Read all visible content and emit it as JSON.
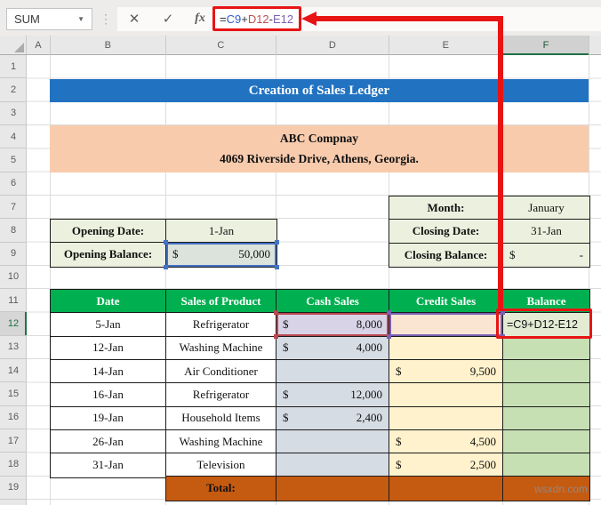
{
  "chrome": {
    "name_box": "SUM",
    "dropdown_icon": "▼",
    "cancel_icon": "✕",
    "enter_icon": "✓",
    "fx_icon": "fx",
    "formula_parts": {
      "eq": "=",
      "ref1": "C9",
      "plus": "+",
      "ref2": "D12",
      "minus": "-",
      "ref3": "E12"
    },
    "columns": [
      "A",
      "B",
      "C",
      "D",
      "E",
      "F"
    ],
    "rows": [
      "1",
      "2",
      "3",
      "4",
      "5",
      "6",
      "7",
      "8",
      "9",
      "10",
      "11",
      "12",
      "13",
      "14",
      "15",
      "16",
      "17",
      "18",
      "19"
    ],
    "selected_column": "F",
    "selected_row": "12"
  },
  "sheet": {
    "title": "Creation of Sales Ledger",
    "company_name": "ABC Compnay",
    "company_address": "4069 Riverside Drive, Athens, Georgia.",
    "opening": {
      "date_label": "Opening Date:",
      "date_value": "1-Jan",
      "balance_label": "Opening Balance:",
      "currency": "$",
      "balance_value": "50,000"
    },
    "closing": {
      "month_label": "Month:",
      "month_value": "January",
      "date_label": "Closing Date:",
      "date_value": "31-Jan",
      "balance_label": "Closing Balance:",
      "currency": "$",
      "balance_value": "-"
    },
    "ledger": {
      "headers": [
        "Date",
        "Sales of Product",
        "Cash Sales",
        "Credit Sales",
        "Balance"
      ],
      "rows": [
        {
          "date": "5-Jan",
          "product": "Refrigerator",
          "cash_sym": "$",
          "cash": "8,000",
          "credit_sym": "",
          "credit": "",
          "balance": "=C9+D12-E12"
        },
        {
          "date": "12-Jan",
          "product": "Washing Machine",
          "cash_sym": "$",
          "cash": "4,000",
          "credit_sym": "",
          "credit": ""
        },
        {
          "date": "14-Jan",
          "product": "Air Conditioner",
          "cash_sym": "",
          "cash": "",
          "credit_sym": "$",
          "credit": "9,500"
        },
        {
          "date": "16-Jan",
          "product": "Refrigerator",
          "cash_sym": "$",
          "cash": "12,000",
          "credit_sym": "",
          "credit": ""
        },
        {
          "date": "19-Jan",
          "product": "Household Items",
          "cash_sym": "$",
          "cash": "2,400",
          "credit_sym": "",
          "credit": ""
        },
        {
          "date": "26-Jan",
          "product": "Washing Machine",
          "cash_sym": "",
          "cash": "",
          "credit_sym": "$",
          "credit": "4,500"
        },
        {
          "date": "31-Jan",
          "product": "Television",
          "cash_sym": "",
          "cash": "",
          "credit_sym": "$",
          "credit": "2,500"
        }
      ],
      "total_label": "Total:"
    }
  },
  "annotation": {
    "formula": "=C9+D12-E12"
  },
  "watermark": "wsxdn.com",
  "colors": {
    "title_bg": "#2173C2",
    "company_banner_bg": "#F8CBAD",
    "info_table_bg": "#EBF1DE",
    "table_header_green": "#00B050",
    "cash_column_fill": "#D6DCE4",
    "credit_column_fill": "#FFF2CC",
    "balance_column_fill": "#C6E0B4",
    "total_row_bg": "#C55A11",
    "annotation_red": "#E81414",
    "ref_blue": "#2F5BCC",
    "ref_red": "#C0504D",
    "ref_purple": "#7B5FB5",
    "selected_header_green": "#1E7145"
  }
}
